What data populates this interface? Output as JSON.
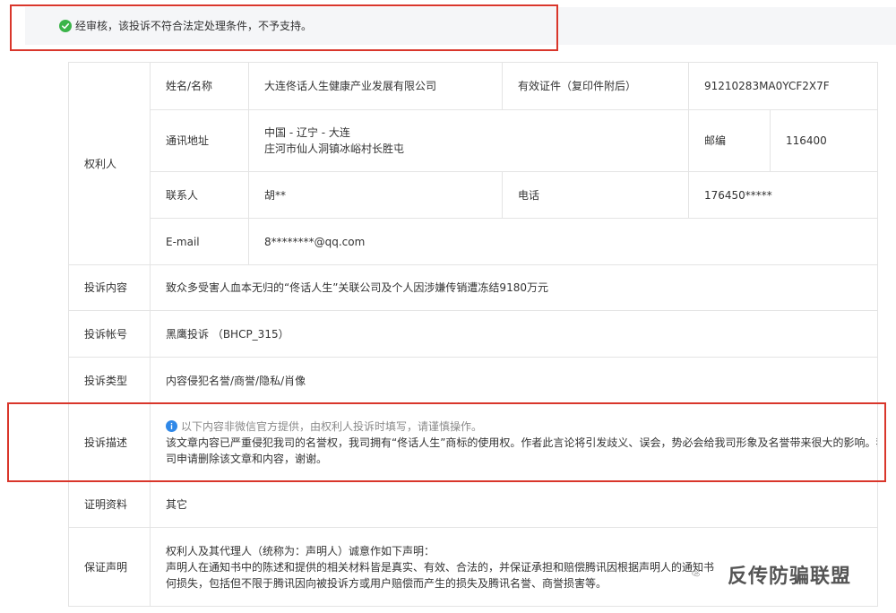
{
  "banner": {
    "icon": "check-circle-icon",
    "text": "经审核，该投诉不符合法定处理条件，不予支持。",
    "icon_color": "#3bb44a"
  },
  "rights_holder": {
    "section_label": "权利人",
    "name_label": "姓名/名称",
    "name_value": "大连佟话人生健康产业发展有限公司",
    "id_label": "有效证件（复印件附后）",
    "id_value": "91210283MA0YCF2X7F",
    "address_label": "通讯地址",
    "address_line1": "中国 - 辽宁 - 大连",
    "address_line2": "庄河市仙人洞镇冰峪村长胜屯",
    "postcode_label": "邮编",
    "postcode_value": "116400",
    "contact_label": "联系人",
    "contact_value": "胡**",
    "phone_label": "电话",
    "phone_value": "176450*****",
    "email_label": "E-mail",
    "email_value": "8********@qq.com"
  },
  "complaint": {
    "content_label": "投诉内容",
    "content_value": "致众多受害人血本无归的“佟话人生”关联公司及个人因涉嫌传销遭冻结9180万元",
    "account_label": "投诉帐号",
    "account_value": "黑鹰投诉 （BHCP_315）",
    "type_label": "投诉类型",
    "type_value": "内容侵犯名誉/商誉/隐私/肖像",
    "desc_label": "投诉描述",
    "desc_hint": "以下内容非微信官方提供，由权利人投诉时填写，请谨慎操作。",
    "desc_line1": "该文章内容已严重侵犯我司的名誉权，我司拥有“佟话人生”商标的使用权。作者此言论将引发歧义、误会，势必会给我司形象及名誉带来很大的影响。我",
    "desc_line2": "司申请删除该文章和内容，谢谢。",
    "proof_label": "证明资料",
    "proof_value": "其它",
    "guarantee_label": "保证声明",
    "guarantee_line1": "权利人及其代理人（统称为：声明人）诚意作如下声明：",
    "guarantee_line2": "声明人在通知书中的陈述和提供的相关材料皆是真实、有效、合法的，并保证承担和赔偿腾讯因根据声明人的通知书",
    "guarantee_line3": "何损失，包括但不限于腾讯因向被投诉方或用户赔偿而产生的损失及腾讯名誉、商誉损害等。"
  },
  "watermark": {
    "text": "反传防骗联盟",
    "icon": "wechat-icon"
  },
  "colors": {
    "highlight_border": "#d9362b",
    "info_icon": "#2f88e8",
    "banner_bg": "#f5f6f8",
    "border": "#e4e4e4"
  }
}
